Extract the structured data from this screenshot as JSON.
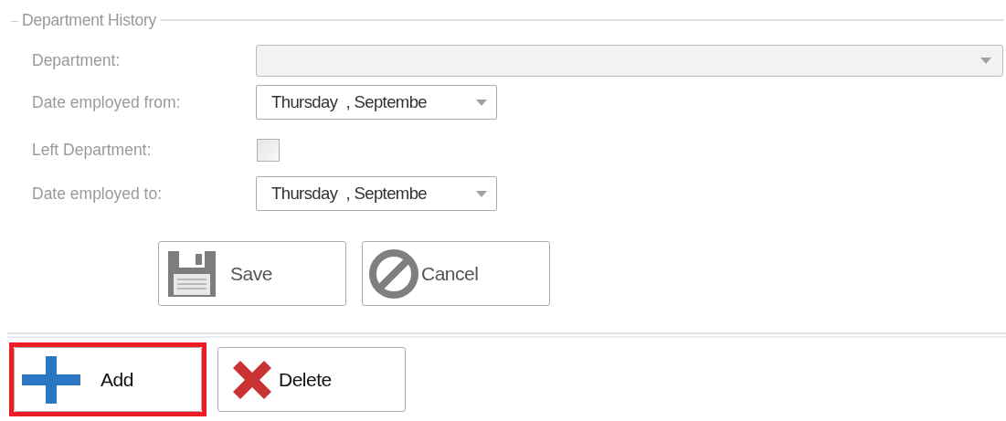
{
  "section": {
    "title": "Department History"
  },
  "fields": [
    {
      "kind": "combo",
      "label": "Department:",
      "disabled": true
    },
    {
      "kind": "date",
      "label": "Date employed from:",
      "value": "Thursday  , Septembe",
      "disabled": false
    },
    {
      "kind": "checkbox",
      "label": "Left Department:",
      "checked": false,
      "disabled": true
    },
    {
      "kind": "date",
      "label": "Date employed to:",
      "value": "Thursday  , Septembe",
      "disabled": false
    }
  ],
  "form_buttons": [
    {
      "kind": "save",
      "label": "Save",
      "disabled": true,
      "highlighted": false
    },
    {
      "kind": "cancel",
      "label": "Cancel",
      "disabled": true,
      "highlighted": false
    }
  ],
  "list_buttons": [
    {
      "kind": "add",
      "label": "Add",
      "disabled": false,
      "highlighted": true
    },
    {
      "kind": "delete",
      "label": "Delete",
      "disabled": false,
      "highlighted": false
    }
  ]
}
